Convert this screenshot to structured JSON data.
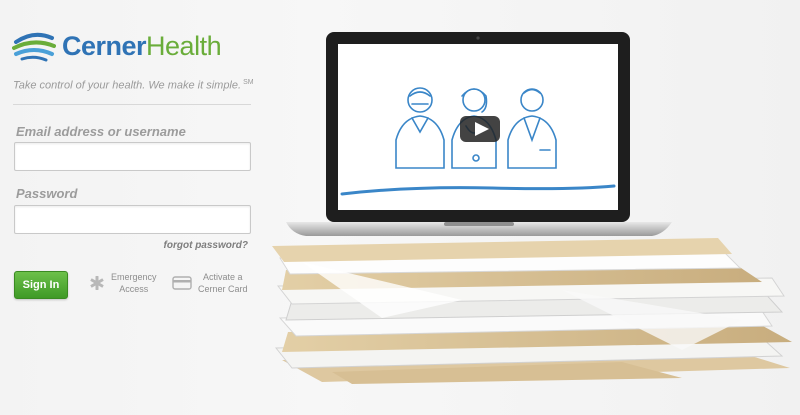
{
  "brand": {
    "part1": "Cerner",
    "part2": "Health"
  },
  "tagline": {
    "text": "Take control of your health. We make it simple.",
    "mark": "SM"
  },
  "login": {
    "email_label": "Email  address or username",
    "email_value": "",
    "password_label": "Password",
    "password_value": "",
    "forgot_label": "forgot password?",
    "signin_label": "Sign In"
  },
  "actions": {
    "emergency": {
      "line1": "Emergency",
      "line2": "Access",
      "icon": "medical-star-icon"
    },
    "activate": {
      "line1": "Activate a",
      "line2": "Cerner Card",
      "icon": "card-icon"
    }
  },
  "video": {
    "play_icon": "play-icon"
  },
  "colors": {
    "brand_blue": "#2f73b5",
    "brand_green": "#6aad3a",
    "signin_green": "#4fae30",
    "sketch_blue": "#3a86c8"
  }
}
